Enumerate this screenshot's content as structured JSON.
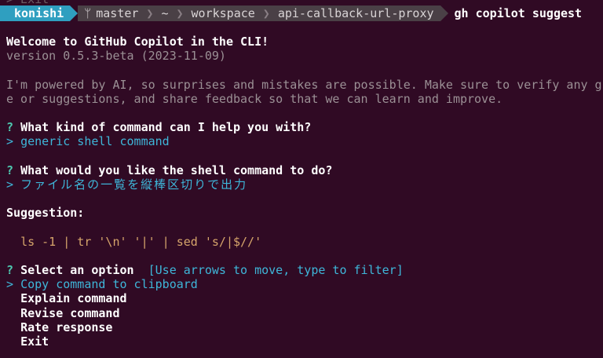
{
  "ghost_line": "> Exit",
  "prompt": {
    "user": "konishi",
    "branch": "master",
    "home": "~",
    "dir1": "workspace",
    "dir2": "api-callback-url-proxy",
    "command": "gh copilot suggest"
  },
  "welcome": {
    "title": "Welcome to GitHub Copilot in the CLI!",
    "version": "version 0.5.3-beta (2023-11-09)",
    "disclaimer_1": "I'm powered by AI, so surprises and mistakes are possible. Make sure to verify any g",
    "disclaimer_2": "e or suggestions, and share feedback so that we can learn and improve."
  },
  "q1": {
    "mark": "?",
    "question": "What kind of command can I help you with?",
    "answer_mark": ">",
    "answer": "generic shell command"
  },
  "q2": {
    "mark": "?",
    "question": "What would you like the shell command to do?",
    "answer_mark": ">",
    "answer": "ファイル名の一覧を縦棒区切りで出力"
  },
  "suggestion": {
    "label": "Suggestion:",
    "command": "ls -1 | tr '\\n' '|' | sed 's/|$//'"
  },
  "select": {
    "mark": "?",
    "label": "Select an option",
    "hint": "[Use arrows to move, type to filter]",
    "cursor": ">",
    "options": [
      "Copy command to clipboard",
      "Explain command",
      "Revise command",
      "Rate response",
      "Exit"
    ]
  },
  "colors": {
    "background": "#300a24",
    "accent": "#2f9fc0",
    "answer": "#3eb6d9",
    "code": "#d6a56b"
  }
}
